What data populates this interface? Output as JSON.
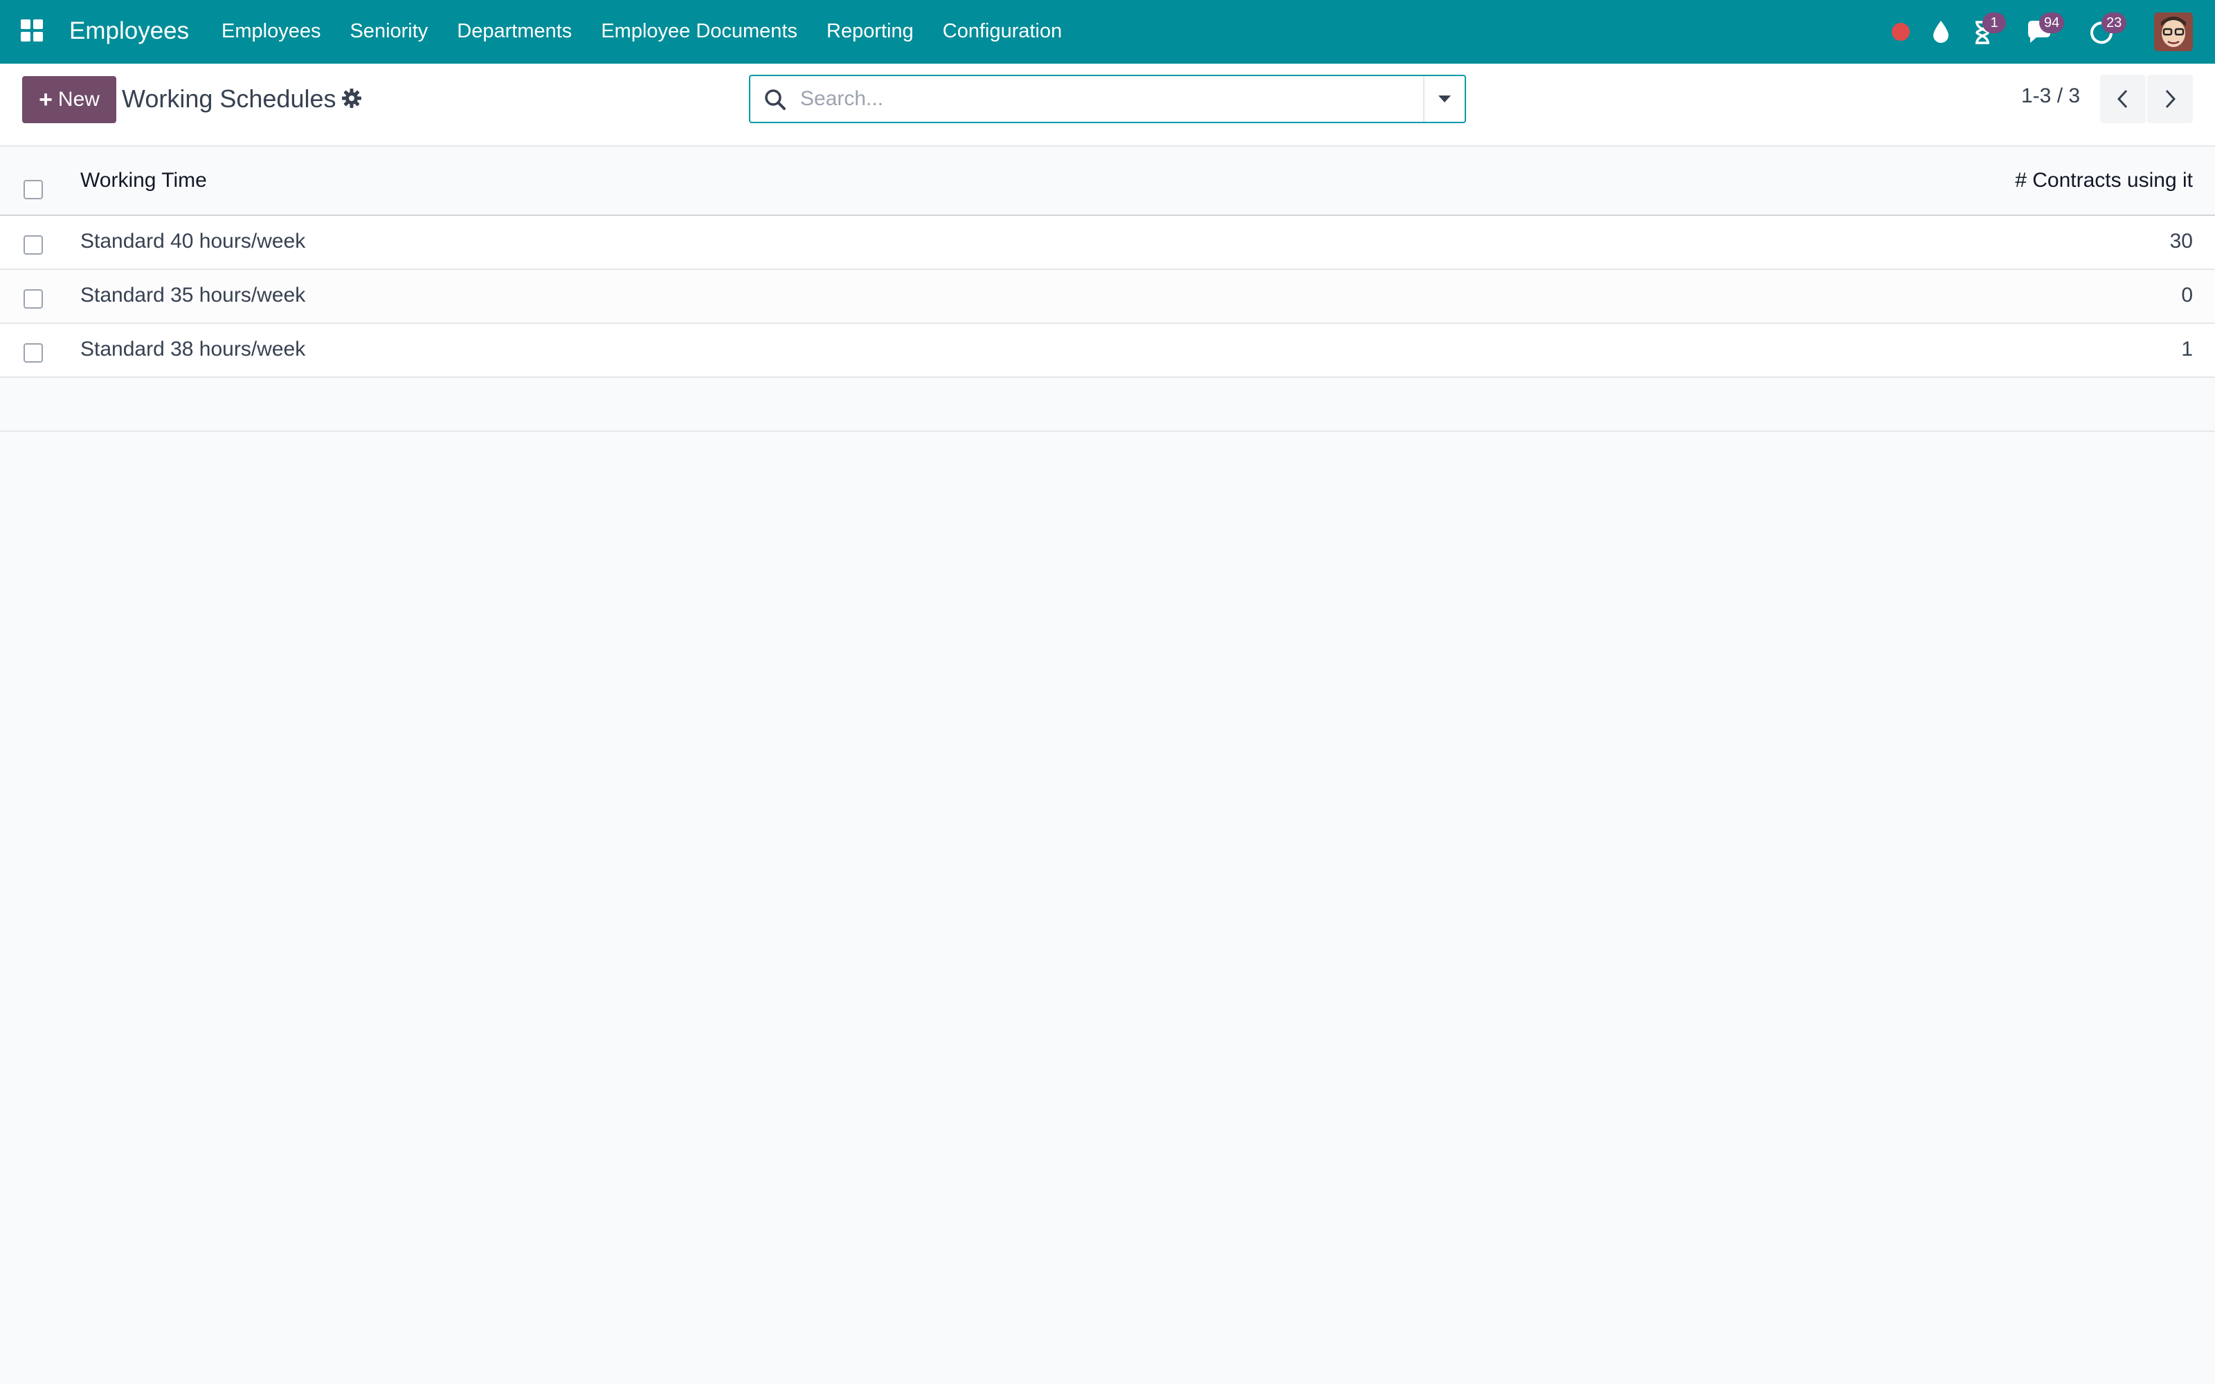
{
  "navbar": {
    "brand": "Employees",
    "menu": [
      {
        "label": "Employees"
      },
      {
        "label": "Seniority"
      },
      {
        "label": "Departments"
      },
      {
        "label": "Employee Documents"
      },
      {
        "label": "Reporting"
      },
      {
        "label": "Configuration"
      }
    ],
    "systray": {
      "activities_count": "1",
      "messages_count": "94",
      "updates_count": "23"
    },
    "colors": {
      "navbar_bg": "#018d99",
      "badge": "#7c4a7e",
      "recording_dot": "#e04a4a"
    }
  },
  "control_panel": {
    "new_label": "New",
    "title": "Working Schedules",
    "search_placeholder": "Search...",
    "pager": "1-3 / 3",
    "colors": {
      "primary": "#714b67",
      "search_border": "#019aa8"
    }
  },
  "list": {
    "columns": [
      "Working Time",
      "# Contracts using it"
    ],
    "rows": [
      {
        "name": "Standard 40 hours/week",
        "contracts": "30"
      },
      {
        "name": "Standard 35 hours/week",
        "contracts": "0"
      },
      {
        "name": "Standard 38 hours/week",
        "contracts": "1"
      }
    ]
  },
  "icons": [
    "apps-grid-icon",
    "recording-dot-icon",
    "drop-icon",
    "hourglass-icon",
    "chat-icon",
    "clock-refresh-icon",
    "gear-icon",
    "search-icon",
    "caret-down-icon",
    "chevron-left-icon",
    "chevron-right-icon"
  ]
}
